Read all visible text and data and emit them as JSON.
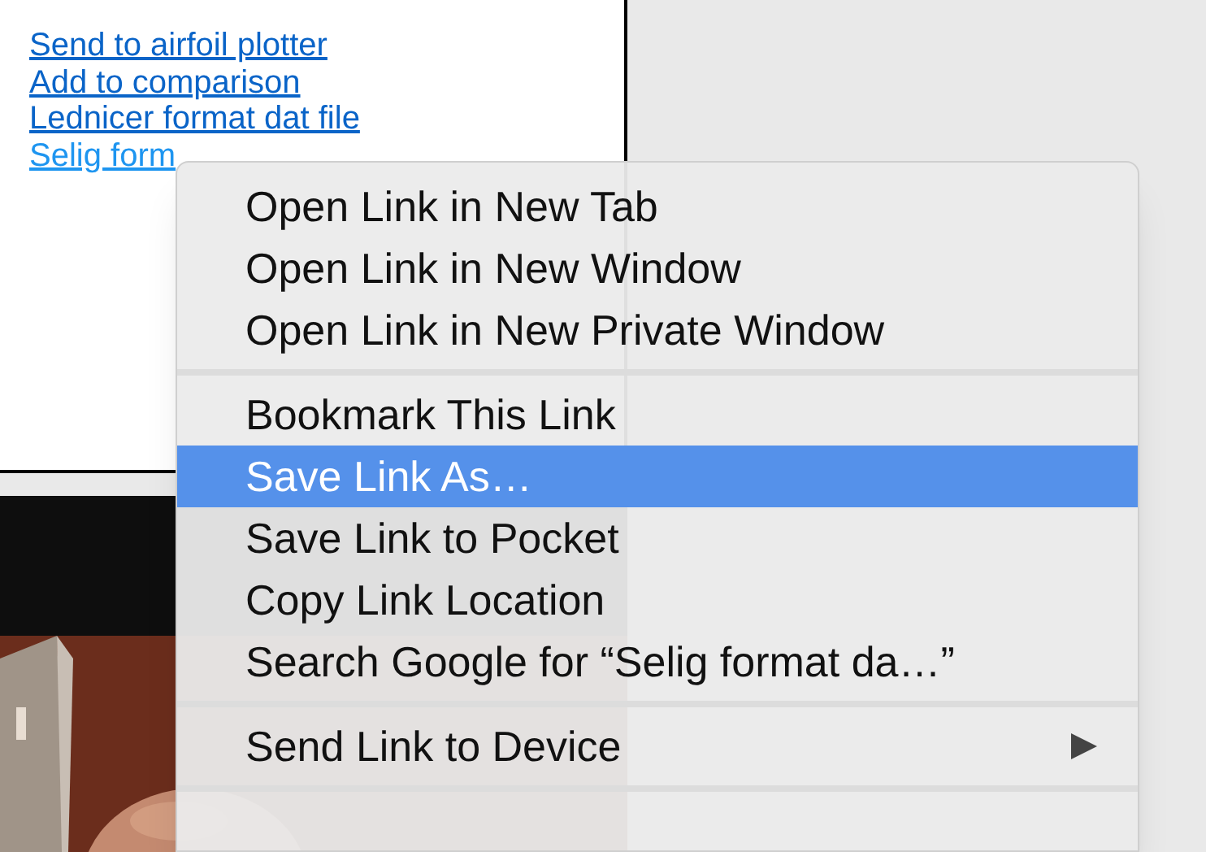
{
  "links": [
    {
      "text": "Send to airfoil plotter",
      "hovered": false
    },
    {
      "text": "Add to comparison",
      "hovered": false
    },
    {
      "text": "Lednicer format dat file",
      "hovered": false
    },
    {
      "text": "Selig form",
      "hovered": true
    }
  ],
  "context_menu": {
    "items": [
      {
        "kind": "item",
        "label": "Open Link in New Tab",
        "selected": false
      },
      {
        "kind": "item",
        "label": "Open Link in New Window",
        "selected": false
      },
      {
        "kind": "item",
        "label": "Open Link in New Private Window",
        "selected": false
      },
      {
        "kind": "separator"
      },
      {
        "kind": "item",
        "label": "Bookmark This Link",
        "selected": false
      },
      {
        "kind": "item",
        "label": "Save Link As…",
        "selected": true
      },
      {
        "kind": "item",
        "label": "Save Link to Pocket",
        "selected": false
      },
      {
        "kind": "item",
        "label": "Copy Link Location",
        "selected": false
      },
      {
        "kind": "item",
        "label": "Search Google for “Selig format da…”",
        "selected": false
      },
      {
        "kind": "separator"
      },
      {
        "kind": "submenu",
        "label": "Send Link to Device",
        "selected": false
      },
      {
        "kind": "separator"
      }
    ]
  }
}
